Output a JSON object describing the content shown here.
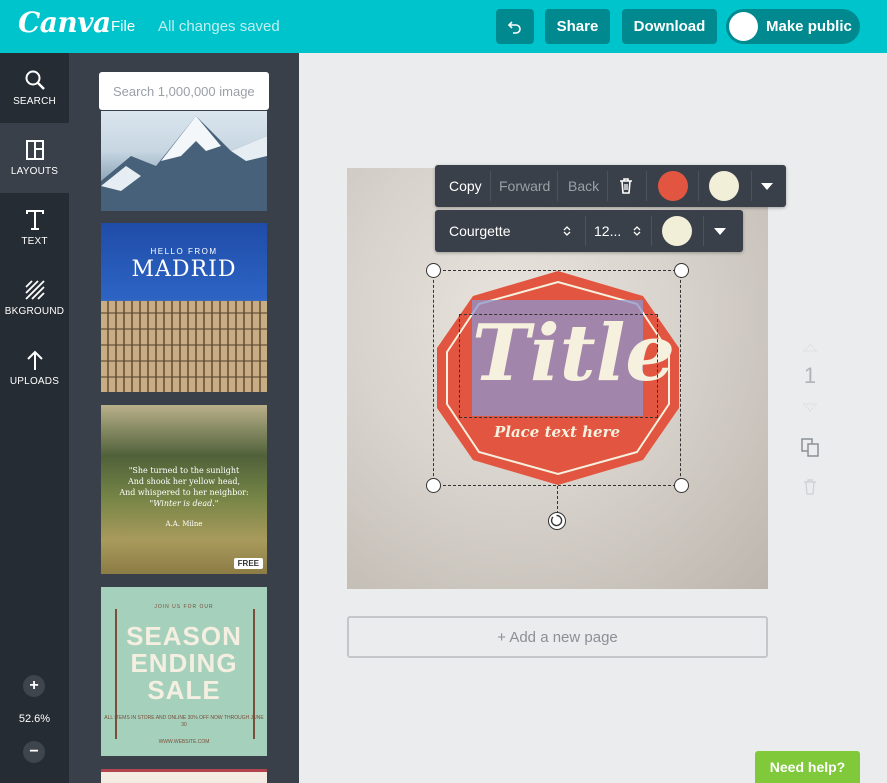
{
  "topbar": {
    "logo": "Canva",
    "file_label": "File",
    "saved_status": "All changes saved",
    "share_label": "Share",
    "download_label": "Download",
    "make_public_label": "Make public"
  },
  "rail": {
    "items": [
      {
        "label": "SEARCH",
        "icon": "search-icon"
      },
      {
        "label": "LAYOUTS",
        "icon": "layouts-icon"
      },
      {
        "label": "TEXT",
        "icon": "text-icon"
      },
      {
        "label": "BKGROUND",
        "icon": "background-icon"
      },
      {
        "label": "UPLOADS",
        "icon": "upload-icon"
      }
    ],
    "active": "LAYOUTS",
    "zoom_level": "52.6%",
    "zoom_in": "+",
    "zoom_out": "−"
  },
  "panel": {
    "search_placeholder": "Search 1,000,000 image",
    "madrid": {
      "hello": "HELLO FROM",
      "title": "MADRID"
    },
    "quote": {
      "lines": [
        "\"She turned to the sunlight",
        "And shook her yellow head,",
        "And whispered to her neighbor:"
      ],
      "emphasis": "\"Winter is dead.\"",
      "author": "A.A. Milne",
      "badge": "FREE"
    },
    "sale": {
      "top": "JOIN US FOR OUR",
      "word1": "SEASON",
      "word2": "ENDING",
      "word3": "SALE",
      "small": "ALL ITEMS IN STORE AND ONLINE 30% OFF NOW THROUGH JUNE 30",
      "site": "WWW.WEBSITE.COM"
    }
  },
  "toolbar": {
    "copy_label": "Copy",
    "forward_label": "Forward",
    "back_label": "Back",
    "font_name": "Courgette",
    "font_size": "12...",
    "color_primary": "#e25641",
    "color_secondary": "#f2efd9"
  },
  "design": {
    "title": "Title",
    "subtitle": "Place text here",
    "badge_color": "#e25641"
  },
  "page_controls": {
    "page_number": "1"
  },
  "add_page_label": "+ Add a new page",
  "help_label": "Need help?"
}
